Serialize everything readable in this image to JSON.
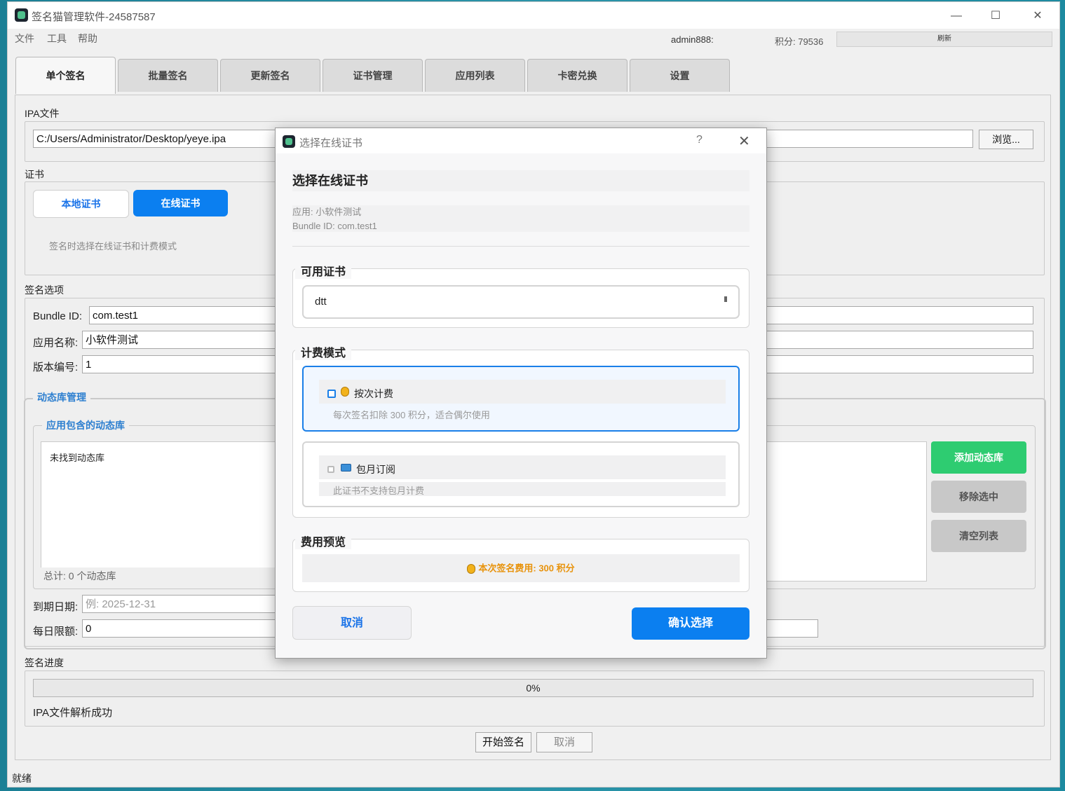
{
  "window": {
    "title": "签名猫管理软件-24587587",
    "minimize": "—",
    "maximize": "☐",
    "close": "✕"
  },
  "menu": [
    "文件",
    "工具",
    "帮助"
  ],
  "account": {
    "user": "admin888:",
    "points": "积分: 79536",
    "refresh": "刷新"
  },
  "tabs": [
    "单个签名",
    "批量签名",
    "更新签名",
    "证书管理",
    "应用列表",
    "卡密兑换",
    "设置"
  ],
  "ipa": {
    "label": "IPA文件",
    "path": "C:/Users/Administrator/Desktop/yeye.ipa",
    "browse": "浏览..."
  },
  "cert": {
    "label": "证书",
    "local": "本地证书",
    "online": "在线证书",
    "hint": "签名时选择在线证书和计费模式"
  },
  "options": {
    "label": "签名选项",
    "bundle_label": "Bundle ID:",
    "bundle_value": "com.test1",
    "name_label": "应用名称:",
    "name_value": "小软件测试",
    "version_label": "版本编号:",
    "version_value": "1"
  },
  "dylib": {
    "title": "动态库管理",
    "sub_title": "应用包含的动态库",
    "empty": "未找到动态库",
    "total": "总计: 0 个动态库",
    "add": "添加动态库",
    "remove": "移除选中",
    "clear": "清空列表",
    "accent_green": "#2ecc71",
    "button_gray": "#c8c8c8"
  },
  "limits": {
    "expire_label": "到期日期:",
    "expire_placeholder": "例: 2025-12-31",
    "daily_label": "每日限额:",
    "daily_value": "0"
  },
  "progress": {
    "label": "签名进度",
    "percent": 0,
    "percent_text": "0%",
    "status": "IPA文件解析成功"
  },
  "actions": {
    "start": "开始签名",
    "cancel": "取消"
  },
  "statusbar": "就绪",
  "dialog": {
    "title": "选择在线证书",
    "help": "?",
    "close": "✕",
    "heading": "选择在线证书",
    "app_line": "应用: 小软件测试",
    "bundle_line": "Bundle ID: com.test1",
    "available_title": "可用证书",
    "selected_cert": "dtt",
    "billing_title": "计费模式",
    "opt1_label": "按次计费",
    "opt1_desc": "每次签名扣除 300 积分，适合偶尔使用",
    "opt2_label": "包月订阅",
    "opt2_desc": "此证书不支持包月计费",
    "fee_title": "费用预览",
    "fee_text": "本次签名费用: 300 积分",
    "cancel": "取消",
    "confirm": "确认选择",
    "accent": "#0b7ff0",
    "fee_color": "#e8930c"
  }
}
